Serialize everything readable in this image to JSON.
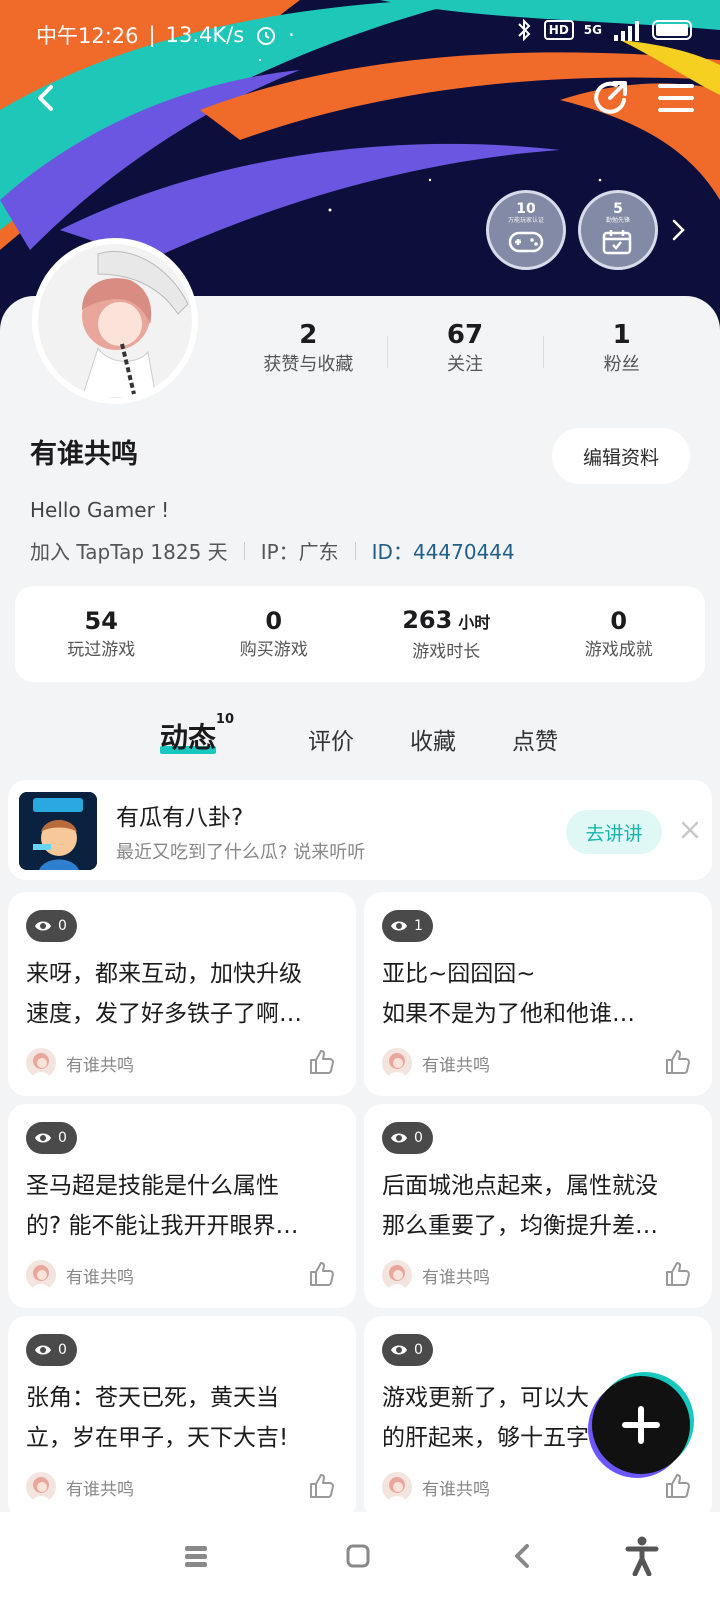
{
  "status_bar": {
    "time": "中午12:26",
    "speed": "13.4K/s",
    "hd_badge": "HD",
    "network": "5G"
  },
  "header": {
    "back_icon": "back-arrow-icon",
    "share_icon": "share-icon",
    "menu_icon": "menu-icon"
  },
  "medals": [
    {
      "number": "10",
      "caption": "万能玩家认证"
    },
    {
      "number": "5",
      "caption": "勤勉先锋"
    }
  ],
  "profile": {
    "followers_stats": [
      {
        "value": "2",
        "label": "获赞与收藏"
      },
      {
        "value": "67",
        "label": "关注"
      },
      {
        "value": "1",
        "label": "粉丝"
      }
    ],
    "username": "有谁共鸣",
    "edit_label": "编辑资料",
    "bio": "Hello Gamer !",
    "joined": "加入 TapTap 1825 天",
    "ip": "IP：广东",
    "id": "ID：44470444"
  },
  "game_stats": [
    {
      "value": "54",
      "unit": "",
      "label": "玩过游戏"
    },
    {
      "value": "0",
      "unit": "",
      "label": "购买游戏"
    },
    {
      "value": "263",
      "unit": "小时",
      "label": "游戏时长"
    },
    {
      "value": "0",
      "unit": "",
      "label": "游戏成就"
    }
  ],
  "tabs": [
    {
      "label": "动态",
      "badge": "10",
      "active": true
    },
    {
      "label": "评价",
      "badge": "",
      "active": false
    },
    {
      "label": "收藏",
      "badge": "",
      "active": false
    },
    {
      "label": "点赞",
      "badge": "",
      "active": false
    }
  ],
  "promo": {
    "title": "有瓜有八卦?",
    "subtitle": "最近又吃到了什么瓜? 说来听听",
    "button": "去讲讲"
  },
  "posts": [
    {
      "views": "0",
      "line1": "来呀，都来互动，加快升级",
      "line2": "速度，发了好多铁子了啊…",
      "author": "有谁共鸣"
    },
    {
      "views": "1",
      "line1": "亚比~囧囧囧~",
      "line2": "如果不是为了他和他谁…",
      "author": "有谁共鸣"
    },
    {
      "views": "0",
      "line1": "圣马超是技能是什么属性",
      "line2": "的? 能不能让我开开眼界…",
      "author": "有谁共鸣"
    },
    {
      "views": "0",
      "line1": "后面城池点起来，属性就没",
      "line2": "那么重要了，均衡提升差…",
      "author": "有谁共鸣"
    },
    {
      "views": "0",
      "line1": "张角：苍天已死，黄天当",
      "line2": "立，岁在甲子，天下大吉!",
      "author": "有谁共鸣"
    },
    {
      "views": "0",
      "line1": "游戏更新了，可以大",
      "line2": "的肝起来，够十五字…",
      "author": "有谁共鸣"
    }
  ],
  "colors": {
    "accent": "#18c8c0",
    "banner_bg": "#0c0f3c",
    "orange": "#f06a2a",
    "teal": "#1fc7b8",
    "purple": "#6a56e0",
    "id_blue": "#1f5f8b"
  }
}
